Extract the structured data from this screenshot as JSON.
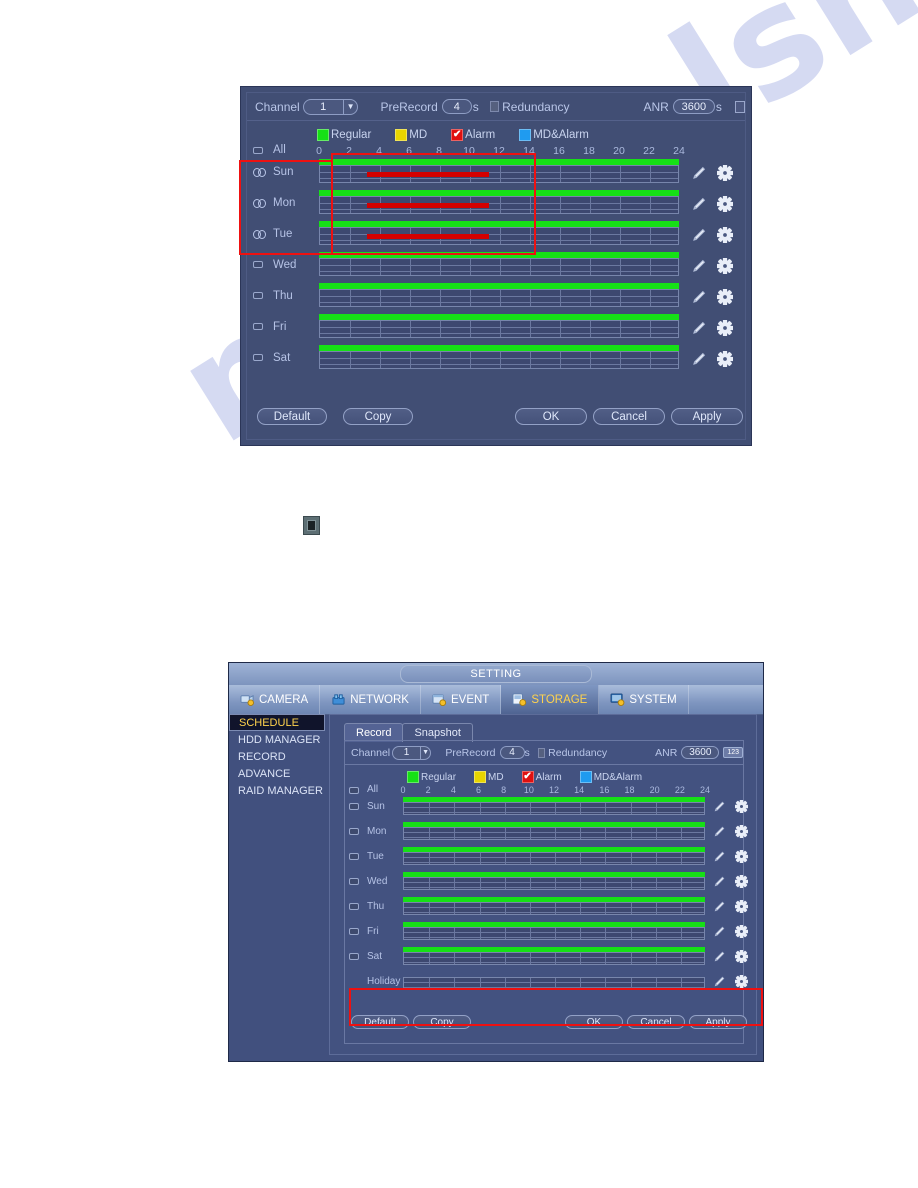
{
  "watermark": {
    "text": "manualshive.com"
  },
  "top_dialog": {
    "channel_label": "Channel",
    "channel_value": "1",
    "prerecord_label": "PreRecord",
    "prerecord_value": "4",
    "prerecord_unit": "s",
    "redundancy_label": "Redundancy",
    "anr_label": "ANR",
    "anr_value": "3600",
    "anr_unit": "s",
    "legend": [
      {
        "label": "Regular",
        "color": "#16e016",
        "checked": false
      },
      {
        "label": "MD",
        "color": "#e8d500",
        "checked": false
      },
      {
        "label": "Alarm",
        "color": "#e01010",
        "checked": true
      },
      {
        "label": "MD&Alarm",
        "color": "#1f9bf0",
        "checked": false
      }
    ],
    "axis_ticks": [
      "0",
      "2",
      "4",
      "6",
      "8",
      "10",
      "12",
      "14",
      "16",
      "18",
      "20",
      "22",
      "24"
    ],
    "all_label": "All",
    "days": [
      {
        "label": "Sun",
        "icon": "chain-icon",
        "green": [
          0,
          24
        ],
        "red": [
          3.2,
          11.3
        ]
      },
      {
        "label": "Mon",
        "icon": "chain-icon",
        "green": [
          0,
          24
        ],
        "red": [
          3.2,
          11.3
        ]
      },
      {
        "label": "Tue",
        "icon": "chain-icon",
        "green": [
          0,
          24
        ],
        "red": [
          3.2,
          11.3
        ]
      },
      {
        "label": "Wed",
        "icon": "checkbox-icon",
        "green": [
          0,
          24
        ],
        "red": null
      },
      {
        "label": "Thu",
        "icon": "checkbox-icon",
        "green": [
          0,
          24
        ],
        "red": null
      },
      {
        "label": "Fri",
        "icon": "checkbox-icon",
        "green": [
          0,
          24
        ],
        "red": null
      },
      {
        "label": "Sat",
        "icon": "checkbox-icon",
        "green": [
          0,
          24
        ],
        "red": null
      }
    ],
    "buttons": {
      "default": "Default",
      "copy": "Copy",
      "ok": "OK",
      "cancel": "Cancel",
      "apply": "Apply"
    },
    "highlight_color": "#ee1111"
  },
  "setting_window": {
    "title": "SETTING",
    "tabs": [
      {
        "label": "CAMERA",
        "icon": "camera-icon",
        "active": false
      },
      {
        "label": "NETWORK",
        "icon": "network-icon",
        "active": false
      },
      {
        "label": "EVENT",
        "icon": "event-icon",
        "active": false
      },
      {
        "label": "STORAGE",
        "icon": "storage-icon",
        "active": true
      },
      {
        "label": "SYSTEM",
        "icon": "system-icon",
        "active": false
      }
    ],
    "sidebar": [
      {
        "label": "SCHEDULE",
        "active": true
      },
      {
        "label": "HDD MANAGER",
        "active": false
      },
      {
        "label": "RECORD",
        "active": false
      },
      {
        "label": "ADVANCE",
        "active": false
      },
      {
        "label": "RAID MANAGER",
        "active": false
      }
    ],
    "subtabs": [
      {
        "label": "Record",
        "active": true
      },
      {
        "label": "Snapshot",
        "active": false
      }
    ],
    "channel_label": "Channel",
    "channel_value": "1",
    "prerecord_label": "PreRecord",
    "prerecord_value": "4",
    "prerecord_unit": "s",
    "redundancy_label": "Redundancy",
    "anr_label": "ANR",
    "anr_value": "3600",
    "anr_keypad_icon": "123",
    "legend": [
      {
        "label": "Regular",
        "color": "#16e016",
        "checked": false
      },
      {
        "label": "MD",
        "color": "#e8d500",
        "checked": false
      },
      {
        "label": "Alarm",
        "color": "#e01010",
        "checked": true
      },
      {
        "label": "MD&Alarm",
        "color": "#1f9bf0",
        "checked": false
      }
    ],
    "axis_ticks": [
      "0",
      "2",
      "4",
      "6",
      "8",
      "10",
      "12",
      "14",
      "16",
      "18",
      "20",
      "22",
      "24"
    ],
    "all_label": "All",
    "days": [
      {
        "label": "Sun",
        "icon": "checkbox-icon",
        "green": [
          0,
          24
        ]
      },
      {
        "label": "Mon",
        "icon": "checkbox-icon",
        "green": [
          0,
          24
        ]
      },
      {
        "label": "Tue",
        "icon": "checkbox-icon",
        "green": [
          0,
          24
        ]
      },
      {
        "label": "Wed",
        "icon": "checkbox-icon",
        "green": [
          0,
          24
        ]
      },
      {
        "label": "Thu",
        "icon": "checkbox-icon",
        "green": [
          0,
          24
        ]
      },
      {
        "label": "Fri",
        "icon": "checkbox-icon",
        "green": [
          0,
          24
        ]
      },
      {
        "label": "Sat",
        "icon": "checkbox-icon",
        "green": [
          0,
          24
        ]
      },
      {
        "label": "Holiday",
        "icon": "none",
        "green": null
      }
    ],
    "buttons": {
      "default": "Default",
      "copy": "Copy",
      "ok": "OK",
      "cancel": "Cancel",
      "apply": "Apply"
    },
    "highlight_color": "#ee1111"
  }
}
